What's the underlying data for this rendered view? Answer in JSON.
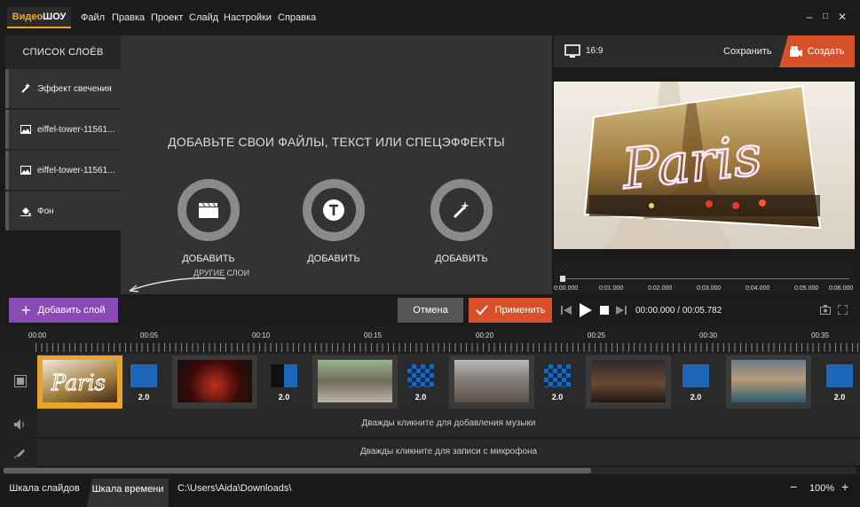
{
  "app": {
    "logo_part1": "Видео",
    "logo_part2": "ШОУ"
  },
  "menu": [
    "Файл",
    "Правка",
    "Проект",
    "Слайд",
    "Настройки",
    "Справка"
  ],
  "window_controls": [
    "–",
    "□",
    "✕"
  ],
  "layers": {
    "title": "СПИСОК СЛОЁВ",
    "items": [
      {
        "label": "Эффект свечения",
        "icon": "magic-wand-icon"
      },
      {
        "label": "eiffel-tower-11561...",
        "icon": "image-icon"
      },
      {
        "label": "eiffel-tower-11561...",
        "icon": "image-icon"
      },
      {
        "label": "Фон",
        "icon": "paint-bucket-icon"
      }
    ]
  },
  "canvas": {
    "hint": "ДОБАВЬТЕ СВОИ ФАЙЛЫ, ТЕКСТ ИЛИ СПЕЦЭФФЕКТЫ",
    "add_labels": [
      "ДОБАВИТЬ",
      "ДОБАВИТЬ",
      "ДОБАВИТЬ"
    ],
    "other_layers": "ДРУГИЕ СЛОИ"
  },
  "preview": {
    "ratio": "16:9",
    "save": "Сохранить",
    "create": "Создать",
    "image_text": "Paris",
    "scrub_labels": [
      "0:00.000",
      "0:01.000",
      "0:02.000",
      "0:03.000",
      "0:04.000",
      "0:05.000",
      "0:06.000"
    ],
    "time": "00:00.000 / 00:05.782"
  },
  "buttons": {
    "add_layer": "Добавить слой",
    "cancel": "Отмена",
    "apply": "Применить"
  },
  "ruler": [
    "00:00",
    "00:05",
    "00:10",
    "00:15",
    "00:20",
    "00:25",
    "00:30",
    "00:35"
  ],
  "transitions": [
    "2.0",
    "2.0",
    "2.0",
    "2.0",
    "2.0",
    "2.0"
  ],
  "tracks": {
    "music": "Дважды кликните для добавления музыки",
    "mic": "Дважды кликните для записи с микрофона"
  },
  "status": {
    "tab_slides": "Шкала слайдов",
    "tab_timeline": "Шкала времени",
    "path": "C:\\Users\\Aida\\Downloads\\",
    "zoom": "100%"
  },
  "colors": {
    "accent_orange": "#d8502a",
    "accent_purple": "#8a4bb5",
    "logo_yellow": "#f0a830",
    "transition_blue": "#1d66b8"
  }
}
